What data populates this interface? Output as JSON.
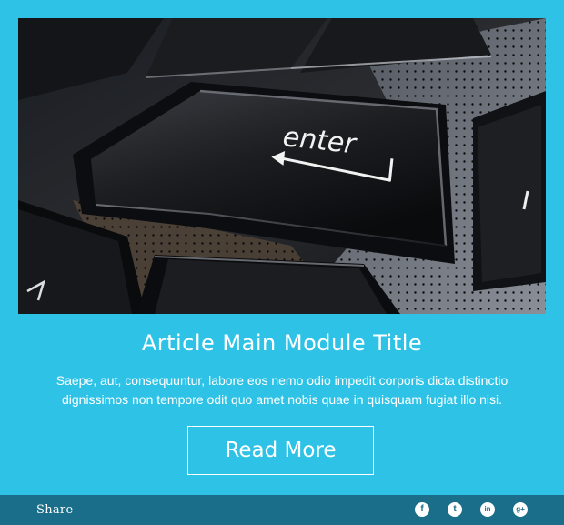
{
  "hero": {
    "key_label": "enter"
  },
  "article": {
    "title": "Article Main Module Title",
    "description": "Saepe, aut, consequuntur, labore eos nemo odio impedit corporis dicta distinctio dignissimos non tempore odit quo amet nobis quae in quisquam fugiat illo nisi.",
    "read_more_label": "Read More"
  },
  "footer": {
    "share_label": "Share",
    "social": [
      {
        "icon": "facebook-icon",
        "glyph": "f"
      },
      {
        "icon": "twitter-icon",
        "glyph": "t"
      },
      {
        "icon": "linkedin-icon",
        "glyph": "in"
      },
      {
        "icon": "google-plus-icon",
        "glyph": "g+"
      }
    ]
  },
  "colors": {
    "background": "#2ec3e6",
    "footer": "#1a6e8a",
    "text": "#ffffff"
  }
}
